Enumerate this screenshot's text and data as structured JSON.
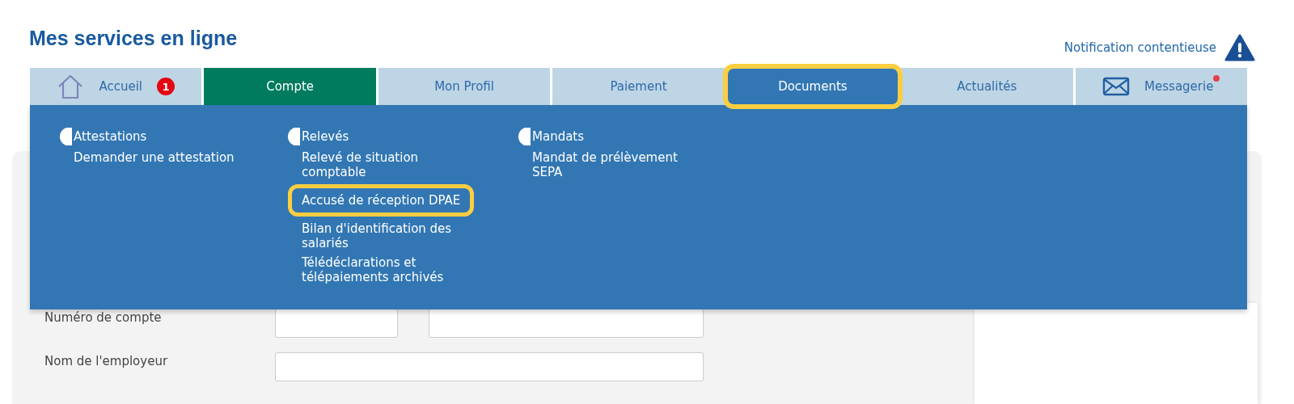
{
  "header": {
    "title": "Mes services en ligne",
    "notification": "Notification contentieuse"
  },
  "tabs": [
    {
      "label": "Accueil",
      "kind": "home",
      "badge": "1",
      "selected": false,
      "open": false,
      "highlighted": false,
      "dot": false
    },
    {
      "label": "Compte",
      "selected": true,
      "open": false,
      "highlighted": false,
      "dot": false
    },
    {
      "label": "Mon Profil",
      "selected": false,
      "open": false,
      "highlighted": false,
      "dot": false
    },
    {
      "label": "Paiement",
      "selected": false,
      "open": false,
      "highlighted": false,
      "dot": false
    },
    {
      "label": "Documents",
      "selected": false,
      "open": true,
      "highlighted": true,
      "dot": false
    },
    {
      "label": "Actualités",
      "selected": false,
      "open": false,
      "highlighted": false,
      "dot": false
    },
    {
      "label": "Messagerie",
      "kind": "mail",
      "selected": false,
      "open": false,
      "highlighted": false,
      "dot": true
    }
  ],
  "menu": {
    "columns": [
      {
        "heading": "Attestations",
        "items": [
          {
            "label": "Demander une attestation",
            "highlighted": false
          }
        ]
      },
      {
        "heading": "Relevés",
        "items": [
          {
            "label": "Relevé de situation comptable",
            "highlighted": false
          },
          {
            "label": "Accusé de réception DPAE",
            "highlighted": true
          },
          {
            "label": "Bilan d'identification des salariés",
            "highlighted": false
          },
          {
            "label": "Télédéclarations et télépaiements archivés",
            "highlighted": false
          }
        ]
      },
      {
        "heading": "Mandats",
        "items": [
          {
            "label": "Mandat de prélèvement SEPA",
            "highlighted": false
          }
        ]
      }
    ]
  },
  "form": {
    "rows": [
      {
        "label": "Numéro de compte",
        "fields": [
          {
            "kind": "short"
          },
          {
            "kind": "long"
          }
        ]
      },
      {
        "label": "Nom de l'employeur",
        "fields": [
          {
            "kind": "wide"
          }
        ]
      }
    ]
  }
}
